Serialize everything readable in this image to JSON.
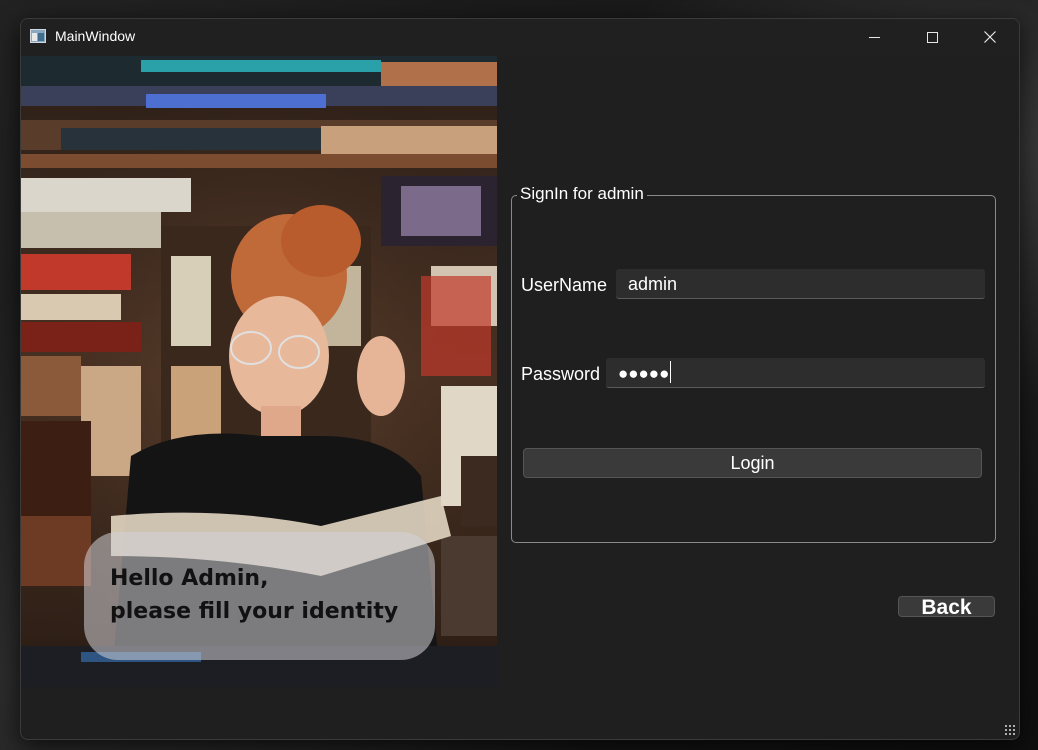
{
  "window": {
    "title": "MainWindow",
    "controls": {
      "minimize": "minimize",
      "maximize": "maximize",
      "close": "close"
    }
  },
  "hero": {
    "greeting_line1": "Hello Admin,",
    "greeting_line2": "please fill your identity"
  },
  "signin": {
    "group_title": "SignIn for admin",
    "username_label": "UserName",
    "username_value": "admin",
    "password_label": "Password",
    "password_masked": "●●●●●",
    "login_label": "Login"
  },
  "footer": {
    "back_label": "Back"
  },
  "colors": {
    "window_bg": "#1f1f1f",
    "field_bg": "#2d2d2d",
    "button_bg": "#3a3a3a",
    "text": "#ffffff"
  }
}
